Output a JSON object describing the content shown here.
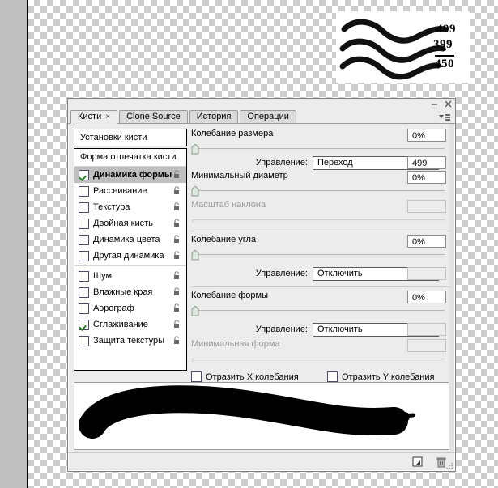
{
  "graphic": {
    "labels": [
      "499",
      "399",
      "450"
    ],
    "stroke_color": "#000000",
    "card_bg": "#ffffff"
  },
  "panel": {
    "titlebar": {
      "minimize_icon": "minimize-icon",
      "close_icon": "close-icon",
      "menu_icon": "panel-menu-icon"
    },
    "tabs": [
      {
        "label": "Кисти",
        "active": true,
        "closable": true
      },
      {
        "label": "Clone Source",
        "active": false,
        "closable": false
      },
      {
        "label": "История",
        "active": false,
        "closable": false
      },
      {
        "label": "Операции",
        "active": false,
        "closable": false
      }
    ],
    "tab_close_glyph": "×"
  },
  "sidebar": {
    "preset_header": "Установки кисти",
    "list_title": "Форма отпечатка кисти",
    "items": [
      {
        "label": "Динамика формы",
        "checked": true,
        "selected": true,
        "locked": true,
        "group_start": false
      },
      {
        "label": "Рассеивание",
        "checked": false,
        "selected": false,
        "locked": true,
        "group_start": false
      },
      {
        "label": "Текстура",
        "checked": false,
        "selected": false,
        "locked": true,
        "group_start": false
      },
      {
        "label": "Двойная кисть",
        "checked": false,
        "selected": false,
        "locked": true,
        "group_start": false
      },
      {
        "label": "Динамика цвета",
        "checked": false,
        "selected": false,
        "locked": true,
        "group_start": false
      },
      {
        "label": "Другая динамика",
        "checked": false,
        "selected": false,
        "locked": true,
        "group_start": false
      },
      {
        "label": "Шум",
        "checked": false,
        "selected": false,
        "locked": true,
        "group_start": true
      },
      {
        "label": "Влажные края",
        "checked": false,
        "selected": false,
        "locked": true,
        "group_start": false
      },
      {
        "label": "Аэрограф",
        "checked": false,
        "selected": false,
        "locked": true,
        "group_start": false
      },
      {
        "label": "Сглаживание",
        "checked": true,
        "selected": false,
        "locked": true,
        "group_start": false
      },
      {
        "label": "Защита текстуры",
        "checked": false,
        "selected": false,
        "locked": true,
        "group_start": false
      }
    ]
  },
  "controls": {
    "size_jitter": {
      "label": "Колебание размера",
      "value": "0%",
      "slider_pos_pct": 0
    },
    "size_control": {
      "label": "Управление:",
      "selected": "Переход",
      "steps_value": "499",
      "steps_enabled": true
    },
    "minimum_diameter": {
      "label": "Минимальный диаметр",
      "value": "0%",
      "slider_pos_pct": 0
    },
    "tilt_scale": {
      "label": "Масштаб наклона",
      "value": "",
      "enabled": false
    },
    "angle_jitter": {
      "label": "Колебание угла",
      "value": "0%",
      "slider_pos_pct": 0
    },
    "angle_control": {
      "label": "Управление:",
      "selected": "Отключить",
      "steps_value": "",
      "steps_enabled": false
    },
    "roundness_jitter": {
      "label": "Колебание формы",
      "value": "0%",
      "slider_pos_pct": 0
    },
    "roundness_control": {
      "label": "Управление:",
      "selected": "Отключить",
      "steps_value": "",
      "steps_enabled": false
    },
    "minimum_roundness": {
      "label": "Минимальная форма",
      "value": "",
      "enabled": false
    },
    "flip_x": {
      "label": "Отразить X колебания",
      "checked": false
    },
    "flip_y": {
      "label": "Отразить Y колебания",
      "checked": false
    }
  },
  "statusbar": {
    "new_brush_icon": "new-brush-icon",
    "delete_brush_icon": "trash-icon",
    "resize_grip": "resize-grip"
  },
  "colors": {
    "panel_bg": "#ececec",
    "selection": "#bfbfbf",
    "check_green": "#2a7a2a",
    "disabled_text": "#9b9b9b"
  }
}
